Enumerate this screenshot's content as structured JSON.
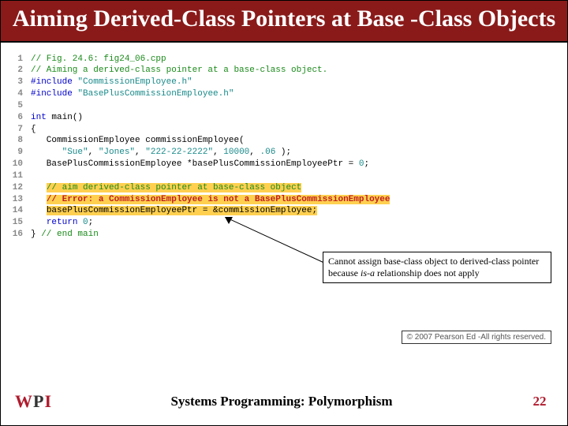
{
  "title": "Aiming Derived-Class Pointers at Base -Class Objects",
  "code": {
    "lines": [
      {
        "n": "1",
        "tokens": [
          {
            "t": "// Fig. 24.6: fig24_06.cpp",
            "cls": "c-comment"
          }
        ]
      },
      {
        "n": "2",
        "tokens": [
          {
            "t": "// Aiming a derived-class pointer at a base-class object.",
            "cls": "c-comment"
          }
        ]
      },
      {
        "n": "3",
        "tokens": [
          {
            "t": "#include ",
            "cls": "c-key"
          },
          {
            "t": "\"CommissionEmployee.h\"",
            "cls": "c-str"
          }
        ]
      },
      {
        "n": "4",
        "tokens": [
          {
            "t": "#include ",
            "cls": "c-key"
          },
          {
            "t": "\"BasePlusCommissionEmployee.h\"",
            "cls": "c-str"
          }
        ]
      },
      {
        "n": "5",
        "tokens": [
          {
            "t": "",
            "cls": ""
          }
        ]
      },
      {
        "n": "6",
        "tokens": [
          {
            "t": "int",
            "cls": "c-key"
          },
          {
            "t": " main()",
            "cls": ""
          }
        ]
      },
      {
        "n": "7",
        "tokens": [
          {
            "t": "{",
            "cls": ""
          }
        ]
      },
      {
        "n": "8",
        "tokens": [
          {
            "t": "   CommissionEmployee commissionEmployee(",
            "cls": ""
          }
        ]
      },
      {
        "n": "9",
        "tokens": [
          {
            "t": "      ",
            "cls": ""
          },
          {
            "t": "\"Sue\"",
            "cls": "c-str"
          },
          {
            "t": ", ",
            "cls": ""
          },
          {
            "t": "\"Jones\"",
            "cls": "c-str"
          },
          {
            "t": ", ",
            "cls": ""
          },
          {
            "t": "\"222-22-2222\"",
            "cls": "c-str"
          },
          {
            "t": ", ",
            "cls": ""
          },
          {
            "t": "10000",
            "cls": "c-num"
          },
          {
            "t": ", ",
            "cls": ""
          },
          {
            "t": ".06",
            "cls": "c-num"
          },
          {
            "t": " );",
            "cls": ""
          }
        ]
      },
      {
        "n": "10",
        "tokens": [
          {
            "t": "   BasePlusCommissionEmployee *basePlusCommissionEmployeePtr = ",
            "cls": ""
          },
          {
            "t": "0",
            "cls": "c-num"
          },
          {
            "t": ";",
            "cls": ""
          }
        ]
      },
      {
        "n": "11",
        "tokens": [
          {
            "t": "",
            "cls": ""
          }
        ]
      },
      {
        "n": "12",
        "tokens": [
          {
            "t": "   ",
            "cls": ""
          },
          {
            "t": "// aim derived-class pointer at base-class object",
            "cls": "c-comment hl"
          }
        ]
      },
      {
        "n": "13",
        "tokens": [
          {
            "t": "   ",
            "cls": ""
          },
          {
            "t": "// Error: a CommissionEmployee is not a BasePlusCommissionEmployee",
            "cls": "hl-err"
          }
        ]
      },
      {
        "n": "14",
        "tokens": [
          {
            "t": "   ",
            "cls": ""
          },
          {
            "t": "basePlusCommissionEmployeePtr = &commissionEmployee;",
            "cls": "hl"
          }
        ]
      },
      {
        "n": "15",
        "tokens": [
          {
            "t": "   ",
            "cls": ""
          },
          {
            "t": "return",
            "cls": "c-key"
          },
          {
            "t": " ",
            "cls": ""
          },
          {
            "t": "0",
            "cls": "c-num"
          },
          {
            "t": ";",
            "cls": ""
          }
        ]
      },
      {
        "n": "16",
        "tokens": [
          {
            "t": "} ",
            "cls": ""
          },
          {
            "t": "// end main",
            "cls": "c-comment"
          }
        ]
      }
    ]
  },
  "callout": {
    "pre": "Cannot assign base-class object to derived-class pointer because ",
    "isa": "is-a",
    "post": " relationship does not apply"
  },
  "copyright": "© 2007 Pearson Ed -All rights reserved.",
  "footer": {
    "logo_w": "W",
    "logo_p": "P",
    "logo_i": "I",
    "text": "Systems Programming:  Polymorphism",
    "page": "22"
  }
}
